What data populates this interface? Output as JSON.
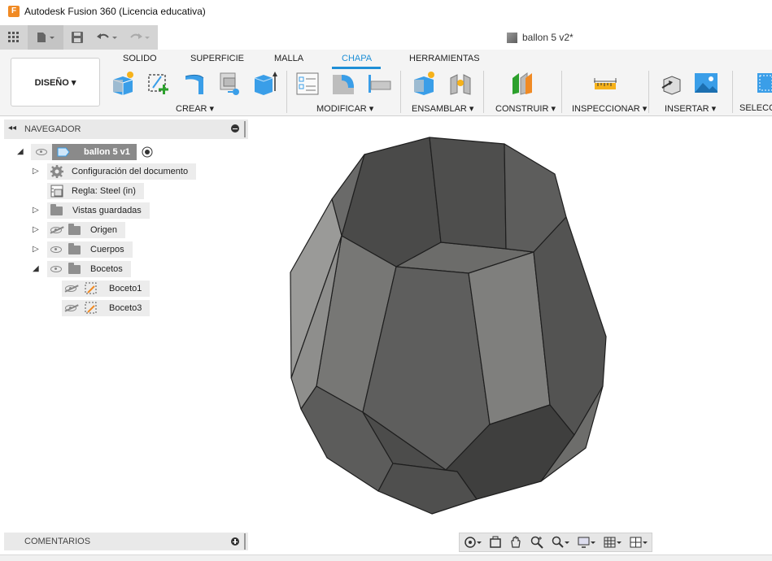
{
  "window": {
    "title": "Autodesk Fusion 360 (Licencia educativa)",
    "logo": "F"
  },
  "document": {
    "tab_title": "ballon 5 v2*"
  },
  "workspace": {
    "label": "DISEÑO ▾"
  },
  "ribbon": {
    "tabs": [
      "SOLIDO",
      "SUPERFICIE",
      "MALLA",
      "CHAPA",
      "HERRAMIENTAS"
    ],
    "active_tab": "CHAPA",
    "groups": [
      "CREAR ▾",
      "MODIFICAR ▾",
      "ENSAMBLAR ▾",
      "CONSTRUIR ▾",
      "INSPECCIONAR ▾",
      "INSERTAR ▾",
      "SELECCIO"
    ]
  },
  "navigator": {
    "title": "NAVEGADOR",
    "root": "ballon 5 v1",
    "items": [
      {
        "label": "Configuración del documento",
        "icon": "gear-icon"
      },
      {
        "label": "Regla: Steel (in)",
        "icon": "ruler-document-icon"
      },
      {
        "label": "Vistas guardadas",
        "icon": "folder-icon"
      },
      {
        "label": "Origen",
        "icon": "folder-icon"
      },
      {
        "label": "Cuerpos",
        "icon": "folder-icon"
      },
      {
        "label": "Bocetos",
        "icon": "folder-icon"
      }
    ],
    "sketches": [
      "Boceto1",
      "Boceto3"
    ]
  },
  "comments": {
    "title": "COMENTARIOS"
  },
  "colors": {
    "accent": "#1f8fd6",
    "model_dark": "#4a4a4a",
    "model_light": "#8c8c8a"
  }
}
